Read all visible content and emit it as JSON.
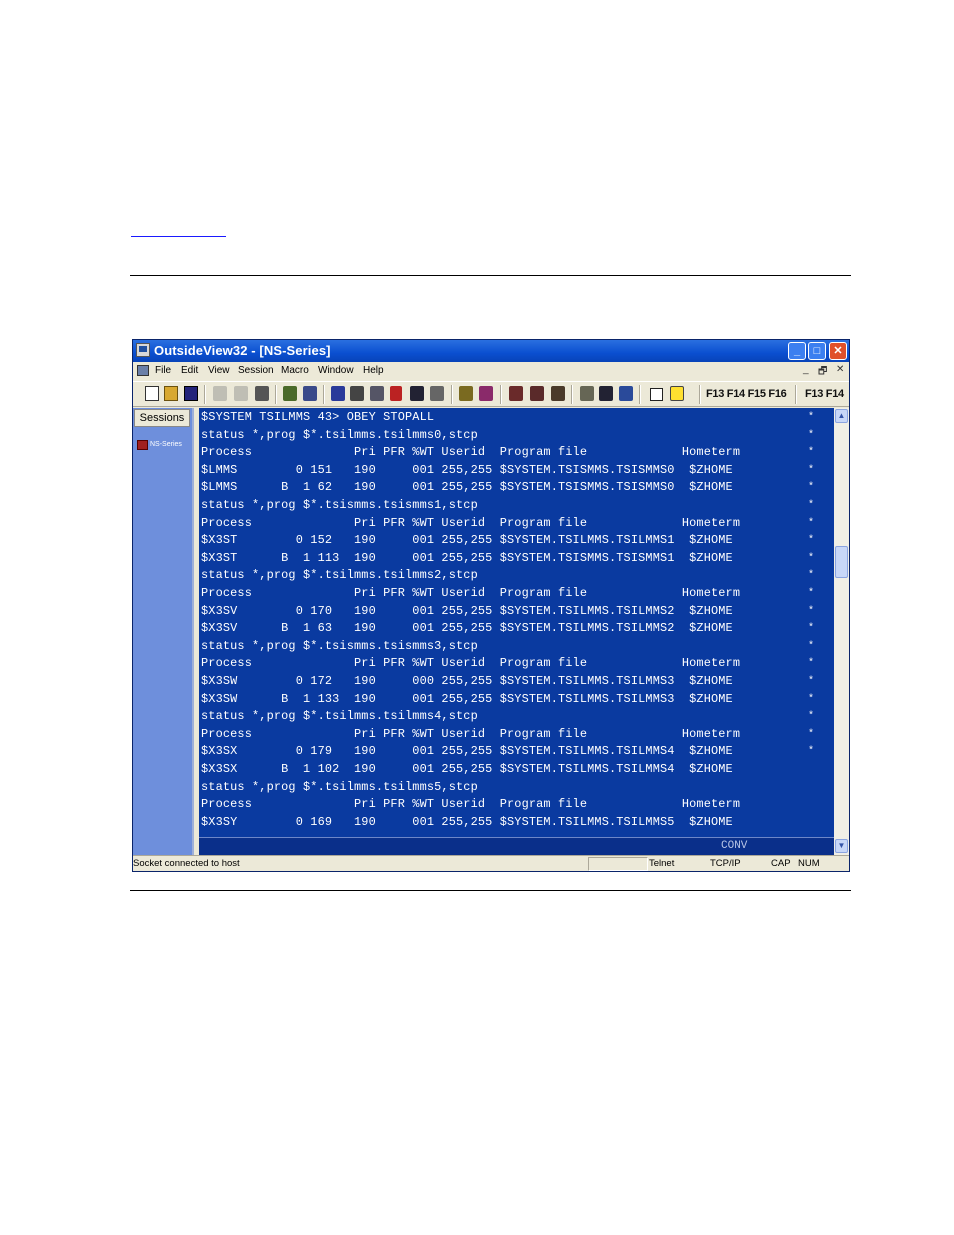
{
  "window": {
    "title": "OutsideView32 - [NS-Series]",
    "title_controls": {
      "minimize": "_",
      "maximize": "□",
      "close": "✕"
    }
  },
  "menubar": {
    "items": [
      "File",
      "Edit",
      "View",
      "Session",
      "Macro",
      "Window",
      "Help"
    ],
    "mdi_controls": [
      "_",
      "🗗",
      "✕"
    ]
  },
  "toolbar": {
    "icons": [
      "new-icon",
      "open-icon",
      "save-icon",
      "cut-icon",
      "paste-icon",
      "print-icon",
      "connect-icon",
      "disconnect-icon",
      "screen-icon",
      "transfer-icon",
      "function-icon",
      "record-icon",
      "macro-icon",
      "keyboard-icon",
      "settings-icon",
      "capture-icon",
      "help-icon"
    ],
    "function_keys_1": "F13 F14 F15 F16",
    "function_keys_2": "F13 F14"
  },
  "sidebar": {
    "tab_label": "Sessions",
    "session_label": "NS-Series"
  },
  "terminal": {
    "lines": [
      "$SYSTEM TSILMMS 43> OBEY STOPALL",
      "status *,prog $*.tsilmms.tsilmms0,stcp",
      "Process              Pri PFR %WT Userid  Program file             Hometerm",
      "$LMMS        0 151   190     001 255,255 $SYSTEM.TSISMMS.TSISMMS0  $ZHOME",
      "$LMMS      B  1 62   190     001 255,255 $SYSTEM.TSISMMS.TSISMMS0  $ZHOME",
      "status *,prog $*.tsismms.tsismms1,stcp",
      "Process              Pri PFR %WT Userid  Program file             Hometerm",
      "$X3ST        0 152   190     001 255,255 $SYSTEM.TSILMMS.TSILMMS1  $ZHOME",
      "$X3ST      B  1 113  190     001 255,255 $SYSTEM.TSISMMS.TSISMMS1  $ZHOME",
      "status *,prog $*.tsilmms.tsilmms2,stcp",
      "Process              Pri PFR %WT Userid  Program file             Hometerm",
      "$X3SV        0 170   190     001 255,255 $SYSTEM.TSILMMS.TSILMMS2  $ZHOME",
      "$X3SV      B  1 63   190     001 255,255 $SYSTEM.TSILMMS.TSILMMS2  $ZHOME",
      "status *,prog $*.tsismms.tsismms3,stcp",
      "Process              Pri PFR %WT Userid  Program file             Hometerm",
      "$X3SW        0 172   190     000 255,255 $SYSTEM.TSILMMS.TSILMMS3  $ZHOME",
      "$X3SW      B  1 133  190     001 255,255 $SYSTEM.TSILMMS.TSILMMS3  $ZHOME",
      "status *,prog $*.tsilmms.tsilmms4,stcp",
      "Process              Pri PFR %WT Userid  Program file             Hometerm",
      "$X3SX        0 179   190     001 255,255 $SYSTEM.TSILMMS.TSILMMS4  $ZHOME",
      "$X3SX      B  1 102  190     001 255,255 $SYSTEM.TSILMMS.TSILMMS4  $ZHOME",
      "status *,prog $*.tsilmms.tsilmms5,stcp",
      "Process              Pri PFR %WT Userid  Program file             Hometerm",
      "$X3SY        0 169   190     001 255,255 $SYSTEM.TSILMMS.TSILMMS5  $ZHOME"
    ],
    "right_markers": [
      "*",
      "*",
      "*",
      "*",
      "*",
      "*",
      "*",
      "*",
      "*",
      "*",
      "*",
      "*",
      "*",
      "*",
      "*",
      "*",
      "*",
      "*",
      "*",
      "*"
    ],
    "mode_indicator": "CONV"
  },
  "statusbar": {
    "message": "Socket connected to host",
    "protocol_1": "Telnet",
    "protocol_2": "TCP/IP",
    "caps": "CAP",
    "num": "NUM"
  },
  "colors": {
    "terminal_bg": "#0a3aa0",
    "terminal_fg": "#ffffff",
    "titlebar": "#0a4fd0",
    "sidebar": "#6e8fdc"
  }
}
